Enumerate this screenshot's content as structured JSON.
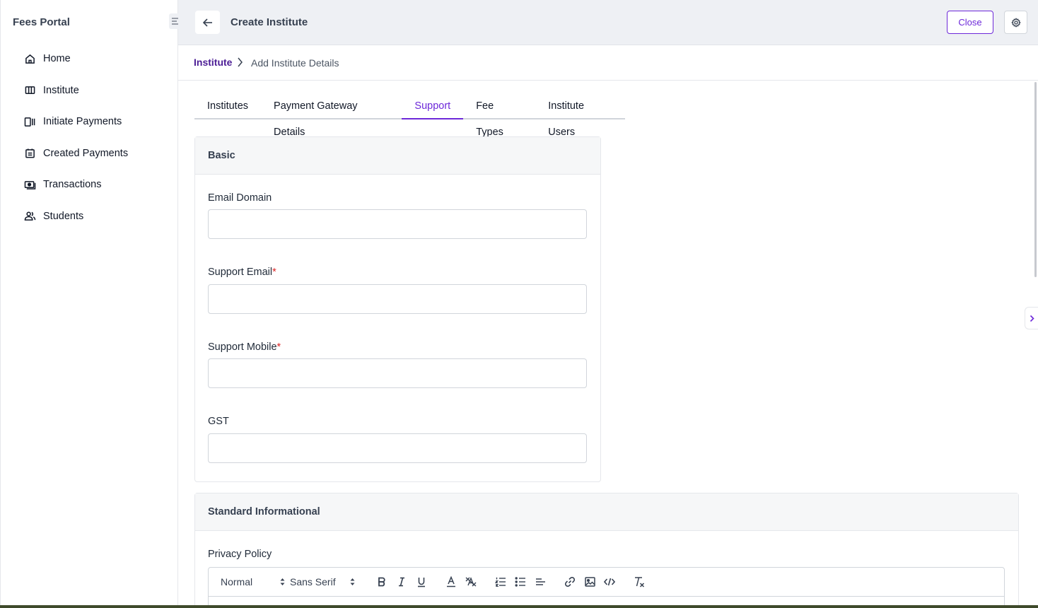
{
  "sidebar": {
    "brand": "Fees Portal",
    "items": [
      {
        "label": "Home",
        "icon": "home-icon"
      },
      {
        "label": "Institute",
        "icon": "columns-icon"
      },
      {
        "label": "Initiate Payments",
        "icon": "payment-icon"
      },
      {
        "label": "Created Payments",
        "icon": "calendar-list-icon"
      },
      {
        "label": "Transactions",
        "icon": "cash-icon"
      },
      {
        "label": "Students",
        "icon": "users-icon"
      }
    ]
  },
  "header": {
    "title": "Create Institute",
    "close_label": "Close"
  },
  "breadcrumb": {
    "parent": "Institute",
    "current": "Add Institute Details"
  },
  "tabs": [
    {
      "label": "Institutes",
      "active": false
    },
    {
      "label": "Payment Gateway Details",
      "active": false
    },
    {
      "label": "Support",
      "active": true
    },
    {
      "label": "Fee Types",
      "active": false
    },
    {
      "label": "Institute Users",
      "active": false
    }
  ],
  "basic": {
    "title": "Basic",
    "fields": [
      {
        "label": "Email Domain",
        "required": false,
        "value": ""
      },
      {
        "label": "Support Email",
        "required": true,
        "value": ""
      },
      {
        "label": "Support Mobile",
        "required": true,
        "value": ""
      },
      {
        "label": "GST",
        "required": false,
        "value": ""
      }
    ],
    "required_mark": "*"
  },
  "standard": {
    "title": "Standard Informational",
    "privacy_label": "Privacy Policy",
    "toolbar": {
      "header_select": "Normal",
      "font_select": "Sans Serif"
    }
  },
  "colors": {
    "accent": "#6d28d9",
    "required": "#dc2626",
    "header_bg": "#eef0f4"
  }
}
